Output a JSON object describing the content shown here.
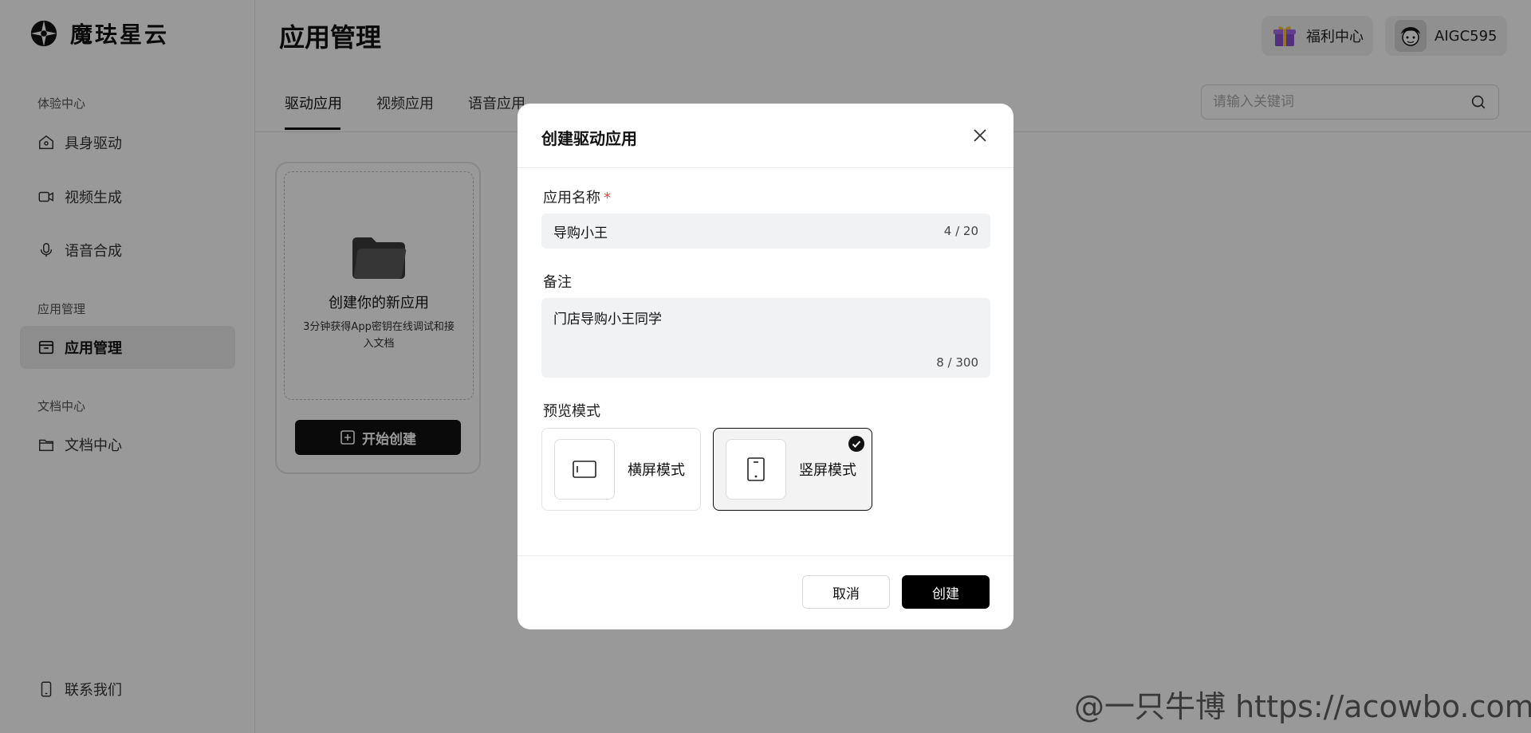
{
  "brand": {
    "name": "魔珐星云"
  },
  "sidebar": {
    "sections": [
      {
        "title": "体验中心",
        "items": [
          {
            "label": "具身驱动",
            "icon": "home-icon"
          },
          {
            "label": "视频生成",
            "icon": "video-icon"
          },
          {
            "label": "语音合成",
            "icon": "microphone-icon"
          }
        ]
      },
      {
        "title": "应用管理",
        "items": [
          {
            "label": "应用管理",
            "icon": "app-box-icon",
            "active": true
          }
        ]
      },
      {
        "title": "文档中心",
        "items": [
          {
            "label": "文档中心",
            "icon": "folder-icon"
          }
        ]
      }
    ],
    "contact": {
      "label": "联系我们",
      "icon": "phone-icon"
    }
  },
  "header": {
    "title": "应用管理",
    "welfare": {
      "label": "福利中心",
      "icon": "gift-icon"
    },
    "user": {
      "name": "AIGC595",
      "icon": "avatar"
    }
  },
  "tabs": [
    {
      "label": "驱动应用",
      "active": true
    },
    {
      "label": "视频应用"
    },
    {
      "label": "语音应用"
    }
  ],
  "search": {
    "placeholder": "请输入关键词",
    "value": ""
  },
  "create_card": {
    "title": "创建你的新应用",
    "description": "3分钟获得App密钥在线调试和接入文档",
    "button_label": "开始创建"
  },
  "modal": {
    "title": "创建驱动应用",
    "name_field": {
      "label": "应用名称",
      "required_mark": "*",
      "value": "导购小王",
      "counter": "4 / 20"
    },
    "note_field": {
      "label": "备注",
      "value": "门店导购小王同学",
      "counter": "8 / 300"
    },
    "preview_mode": {
      "label": "预览模式",
      "options": [
        {
          "label": "横屏模式",
          "icon": "landscape-icon",
          "selected": false
        },
        {
          "label": "竖屏模式",
          "icon": "portrait-icon",
          "selected": true
        }
      ]
    },
    "cancel_label": "取消",
    "create_label": "创建"
  },
  "watermark": "@一只牛博 https://acowbo.com",
  "colors": {
    "primary": "#000000",
    "required": "#e5483d",
    "overlay": "rgba(0,0,0,0.40)"
  }
}
